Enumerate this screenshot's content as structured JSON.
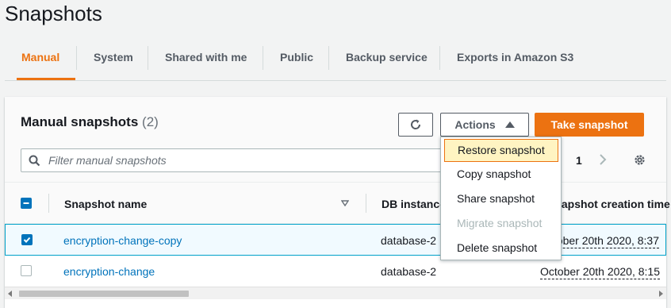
{
  "page": {
    "title": "Snapshots"
  },
  "tabs": [
    {
      "label": "Manual"
    },
    {
      "label": "System"
    },
    {
      "label": "Shared with me"
    },
    {
      "label": "Public"
    },
    {
      "label": "Backup service"
    },
    {
      "label": "Exports in Amazon S3"
    }
  ],
  "panel": {
    "title": "Manual snapshots",
    "count": "(2)",
    "actions_label": "Actions",
    "take_snapshot_label": "Take snapshot",
    "search_placeholder": "Filter manual snapshots",
    "page_number": "1"
  },
  "table": {
    "columns": [
      "Snapshot name",
      "DB instance",
      "Snapshot creation time"
    ],
    "rows": [
      {
        "name": "encryption-change-copy",
        "db_instance": "database-2",
        "created": "October 20th 2020, 8:37",
        "selected": true
      },
      {
        "name": "encryption-change",
        "db_instance": "database-2",
        "created": "October 20th 2020, 8:15",
        "selected": false
      }
    ]
  },
  "actions_menu": [
    {
      "label": "Restore snapshot",
      "state": "highlighted"
    },
    {
      "label": "Copy snapshot",
      "state": "enabled"
    },
    {
      "label": "Share snapshot",
      "state": "enabled"
    },
    {
      "label": "Migrate snapshot",
      "state": "disabled"
    },
    {
      "label": "Delete snapshot",
      "state": "enabled"
    }
  ],
  "colors": {
    "accent": "#ec7211",
    "link": "#0073bb",
    "highlight": "#fff4c2"
  }
}
